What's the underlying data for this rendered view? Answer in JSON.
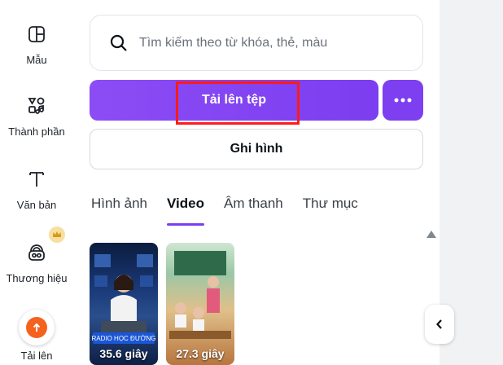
{
  "sidebar": {
    "items": [
      {
        "label": "Mẫu",
        "icon": "template-icon"
      },
      {
        "label": "Thành phần",
        "icon": "elements-icon"
      },
      {
        "label": "Văn bản",
        "icon": "text-icon"
      },
      {
        "label": "Thương hiệu",
        "icon": "brand-icon"
      },
      {
        "label": "Tải lên",
        "icon": "upload-icon"
      }
    ]
  },
  "search": {
    "placeholder": "Tìm kiếm theo từ khóa, thẻ, màu"
  },
  "actions": {
    "upload_label": "Tải lên tệp",
    "more_label": "•••",
    "record_label": "Ghi hình"
  },
  "tabs": [
    {
      "label": "Hình ảnh",
      "active": false
    },
    {
      "label": "Video",
      "active": true
    },
    {
      "label": "Âm thanh",
      "active": false
    },
    {
      "label": "Thư mục",
      "active": false
    }
  ],
  "videos": [
    {
      "badge": "RADIO HỌC ĐƯỜNG",
      "duration": "35.6 giây"
    },
    {
      "duration": "27.3 giây"
    }
  ],
  "colors": {
    "accent": "#7b3ef0",
    "highlight": "#ff1a1a",
    "upload_icon": "#f5621e"
  }
}
